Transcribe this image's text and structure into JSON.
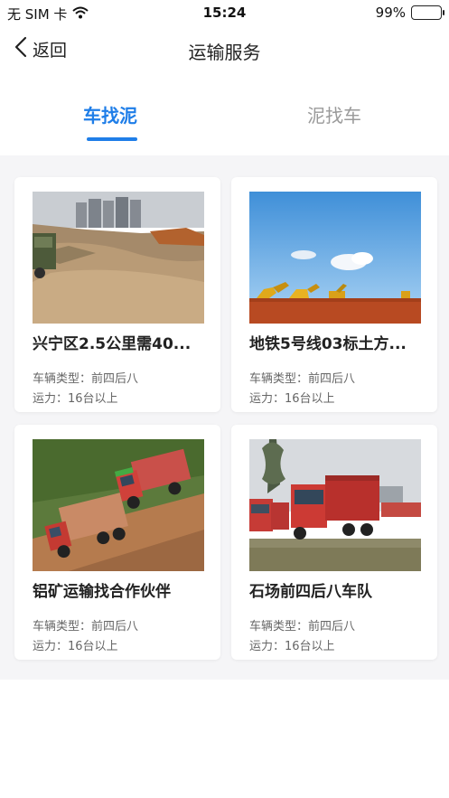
{
  "status_bar": {
    "carrier": "无 SIM 卡",
    "time": "15:24",
    "battery": "99%"
  },
  "nav": {
    "back_label": "返回",
    "title": "运输服务"
  },
  "tabs": [
    {
      "label": "车找泥",
      "active": true
    },
    {
      "label": "泥找车",
      "active": false
    }
  ],
  "cards": [
    {
      "title": "兴宁区2.5公里需40...",
      "vehicle_type": "车辆类型：前四后八",
      "capacity": "运力：16台以上",
      "photo": "construction-site-photo"
    },
    {
      "title": "地铁5号线03标土方...",
      "vehicle_type": "车辆类型：前四后八",
      "capacity": "运力：16台以上",
      "photo": "excavators-photo"
    },
    {
      "title": "铝矿运输找合作伙伴",
      "vehicle_type": "车辆类型：前四后八",
      "capacity": "运力：16台以上",
      "photo": "dump-trucks-photo"
    },
    {
      "title": "石场前四后八车队",
      "vehicle_type": "车辆类型：前四后八",
      "capacity": "运力：16台以上",
      "photo": "truck-fleet-photo"
    }
  ],
  "colors": {
    "accent": "#1f7ee8",
    "inactive_tab": "#9a9a9a",
    "background": "#f5f5f7"
  }
}
